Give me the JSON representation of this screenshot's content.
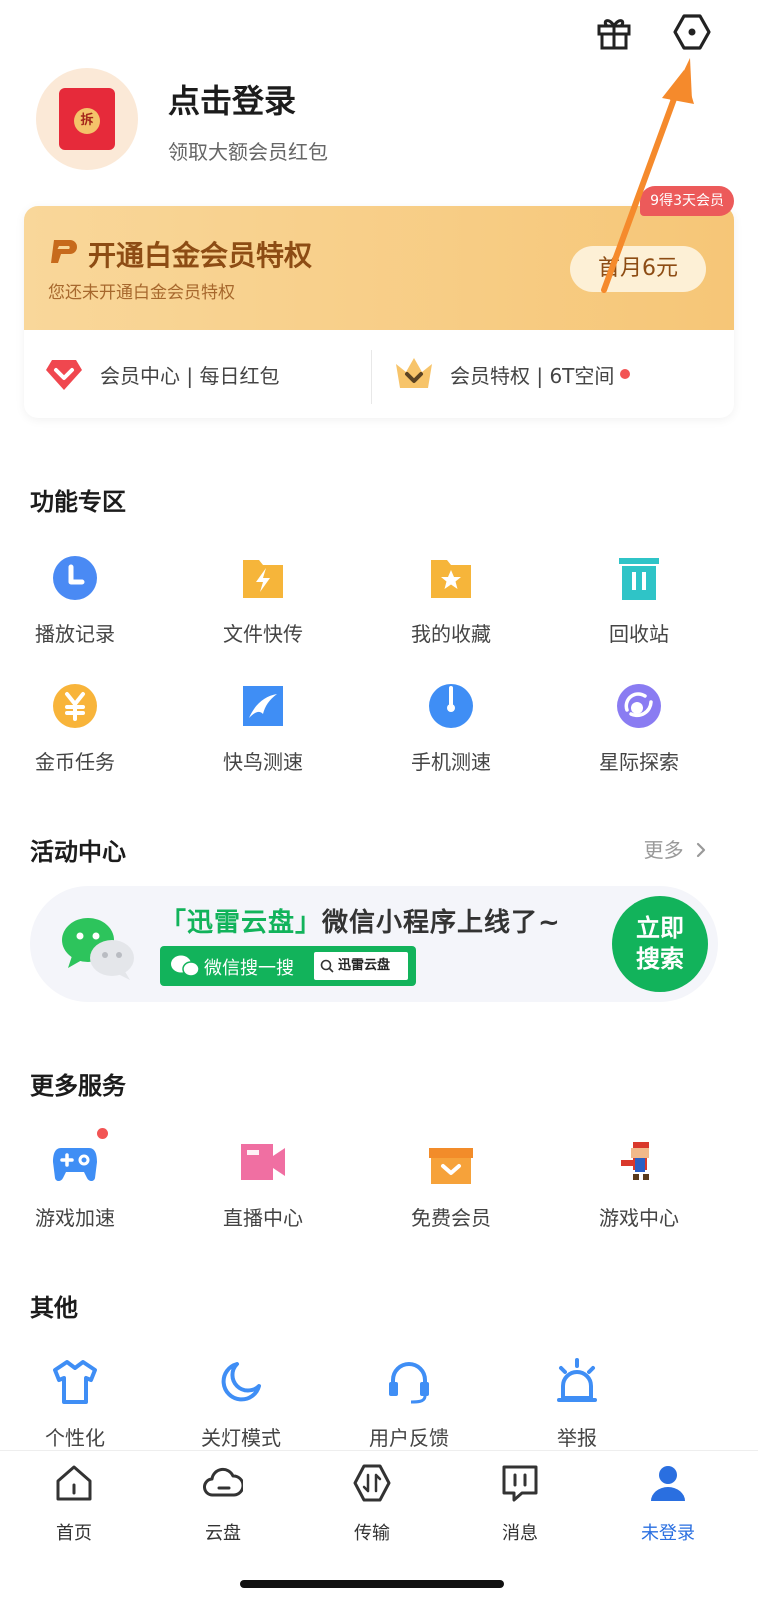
{
  "top_icons": [
    "gift-icon",
    "settings-hexagon-icon"
  ],
  "profile": {
    "title": "点击登录",
    "subtitle": "领取大额会员红包",
    "avatar_seal": "拆"
  },
  "vip": {
    "title": "开通白金会员特权",
    "subtitle": "您还未开通白金会员特权",
    "button": "首月6元",
    "badge": "9得3天会员",
    "link_left": "会员中心 | 每日红包",
    "link_right": "会员特权 | 6T空间"
  },
  "features": {
    "title": "功能专区",
    "items": [
      {
        "label": "播放记录",
        "icon": "history-clock-icon",
        "color": "#4a8af4"
      },
      {
        "label": "文件快传",
        "icon": "folder-lightning-icon",
        "color": "#f6b53a"
      },
      {
        "label": "我的收藏",
        "icon": "folder-star-icon",
        "color": "#f6b53a"
      },
      {
        "label": "回收站",
        "icon": "trash-icon",
        "color": "#2fc4c7"
      },
      {
        "label": "金币任务",
        "icon": "coin-yen-icon",
        "color": "#f8b43a"
      },
      {
        "label": "快鸟测速",
        "icon": "bird-speed-icon",
        "color": "#3f8ef5"
      },
      {
        "label": "手机测速",
        "icon": "phone-speed-icon",
        "color": "#3f8ef5"
      },
      {
        "label": "星际探索",
        "icon": "planet-explore-icon",
        "color": "#8a7cf2"
      }
    ]
  },
  "activity": {
    "title": "活动中心",
    "more": "更多",
    "banner": {
      "title_highlight": "「迅雷云盘」",
      "title_rest": "微信小程序上线了~",
      "search_label": "微信搜一搜",
      "search_box": "迅雷云盘",
      "button_line1": "立即",
      "button_line2": "搜索"
    }
  },
  "services": {
    "title": "更多服务",
    "items": [
      {
        "label": "游戏加速",
        "icon": "gamepad-icon",
        "color": "#3f8ef5"
      },
      {
        "label": "直播中心",
        "icon": "video-camera-icon",
        "color": "#f06fa2"
      },
      {
        "label": "免费会员",
        "icon": "gift-box-icon",
        "color": "#f6a23a"
      },
      {
        "label": "游戏中心",
        "icon": "mario-icon",
        "color": "#d9382b"
      }
    ]
  },
  "others": {
    "title": "其他",
    "items": [
      {
        "label": "个性化",
        "icon": "tshirt-icon",
        "color": "#3f8ef5"
      },
      {
        "label": "关灯模式",
        "icon": "moon-icon",
        "color": "#3f8ef5"
      },
      {
        "label": "用户反馈",
        "icon": "headset-icon",
        "color": "#3f8ef5"
      },
      {
        "label": "举报",
        "icon": "alarm-icon",
        "color": "#3f8ef5"
      }
    ]
  },
  "tabs": [
    {
      "label": "首页",
      "icon": "home-icon"
    },
    {
      "label": "云盘",
      "icon": "cloud-icon"
    },
    {
      "label": "传输",
      "icon": "transfer-icon"
    },
    {
      "label": "消息",
      "icon": "message-icon"
    },
    {
      "label": "未登录",
      "icon": "user-icon"
    }
  ]
}
